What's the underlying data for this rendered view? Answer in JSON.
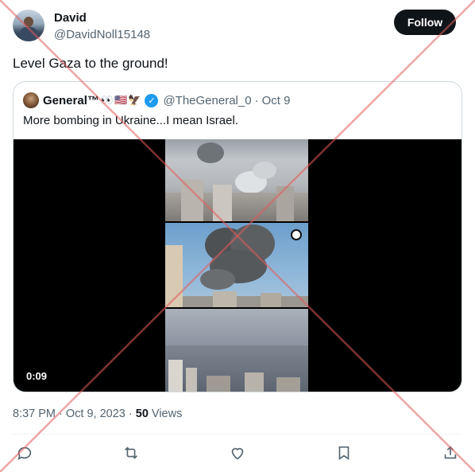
{
  "author": {
    "name": "David",
    "handle": "@DavidNoll15148",
    "follow_label": "Follow"
  },
  "tweet": {
    "text": "Level Gaza to the ground!",
    "time": "8:37 PM",
    "date": "Oct 9, 2023",
    "views_count": "50",
    "views_label": "Views"
  },
  "quoted": {
    "name": "General™",
    "emoji_suffix": "👀🇺🇸🦅",
    "handle": "@TheGeneral_0",
    "date": "Oct 9",
    "text": "More bombing in Ukraine...I mean Israel.",
    "video_duration": "0:09"
  },
  "actions": [
    "reply-icon",
    "retweet-icon",
    "like-icon",
    "bookmark-icon",
    "share-icon"
  ],
  "colors": {
    "follow_bg": "#0f1419",
    "verified": "#1d9bf0",
    "muted_text": "#536471",
    "overlay_x": "#e35b5b"
  }
}
